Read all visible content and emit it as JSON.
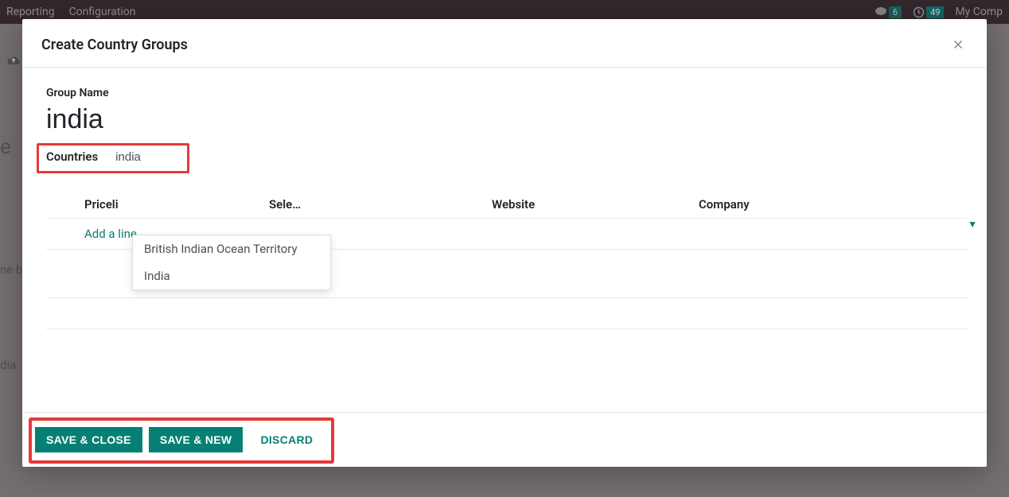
{
  "backdrop": {
    "menu_reporting": "Reporting",
    "menu_configuration": "Configuration",
    "badge1": "6",
    "badge2": "49",
    "company": "My Comp",
    "side_e": "e",
    "side_neb": "ne b",
    "side_dia": "dia"
  },
  "modal": {
    "title": "Create Country Groups",
    "group_name_label": "Group Name",
    "group_name_value": "india",
    "countries_label": "Countries",
    "countries_input_value": "india",
    "dropdown": {
      "option1": "British Indian Ocean Territory",
      "option2": "India"
    },
    "table": {
      "col1": "Priceli",
      "col2": "Sele…",
      "col3": "Website",
      "col4": "Company",
      "add_line": "Add a line"
    },
    "footer": {
      "save_close": "SAVE & CLOSE",
      "save_new": "SAVE & NEW",
      "discard": "DISCARD"
    }
  }
}
